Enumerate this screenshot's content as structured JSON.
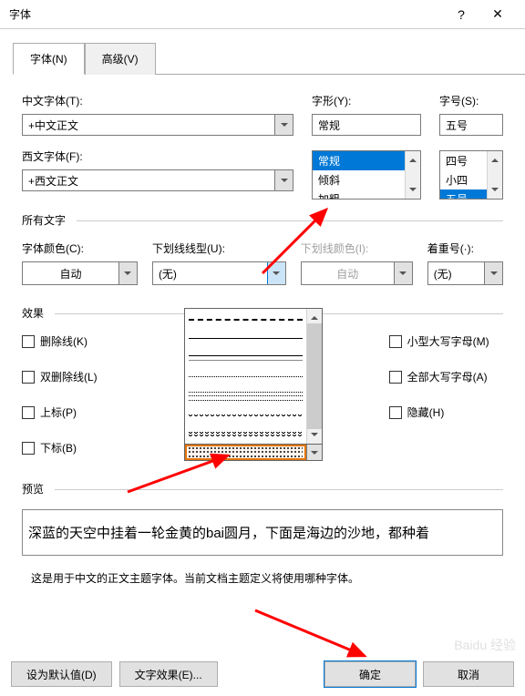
{
  "titlebar": {
    "title": "字体",
    "help": "?",
    "close": "✕"
  },
  "tabs": {
    "font": "字体(N)",
    "advanced": "高级(V)"
  },
  "labels": {
    "cn_font": "中文字体(T):",
    "en_font": "西文字体(F):",
    "style": "字形(Y):",
    "size": "字号(S):",
    "all_text": "所有文字",
    "effects": "效果",
    "preview": "预览",
    "font_color": "字体颜色(C):",
    "underline": "下划线线型(U):",
    "underline_color": "下划线颜色(I):",
    "emphasis": "着重号(·):"
  },
  "values": {
    "cn_font": "+中文正文",
    "en_font": "+西文正文",
    "style": "常规",
    "size": "五号",
    "color": "自动",
    "underline": "(无)",
    "underline_color": "自动",
    "emphasis": "(无)"
  },
  "style_list": [
    "常规",
    "倾斜",
    "加粗"
  ],
  "size_list": [
    "四号",
    "小四",
    "五号"
  ],
  "style_selected": 0,
  "size_selected": 2,
  "checkboxes": {
    "left": [
      "删除线(K)",
      "双删除线(L)",
      "上标(P)",
      "下标(B)"
    ],
    "right": [
      "小型大写字母(M)",
      "全部大写字母(A)",
      "隐藏(H)"
    ]
  },
  "preview_text": "深蓝的天空中挂着一轮金黄的bai圆月，下面是海边的沙地，都种着",
  "preview_note": "这是用于中文的正文主题字体。当前文档主题定义将使用哪种字体。",
  "buttons": {
    "default": "设为默认值(D)",
    "text_effects": "文字效果(E)...",
    "ok": "确定",
    "cancel": "取消"
  },
  "watermark": "Baidu 经验"
}
